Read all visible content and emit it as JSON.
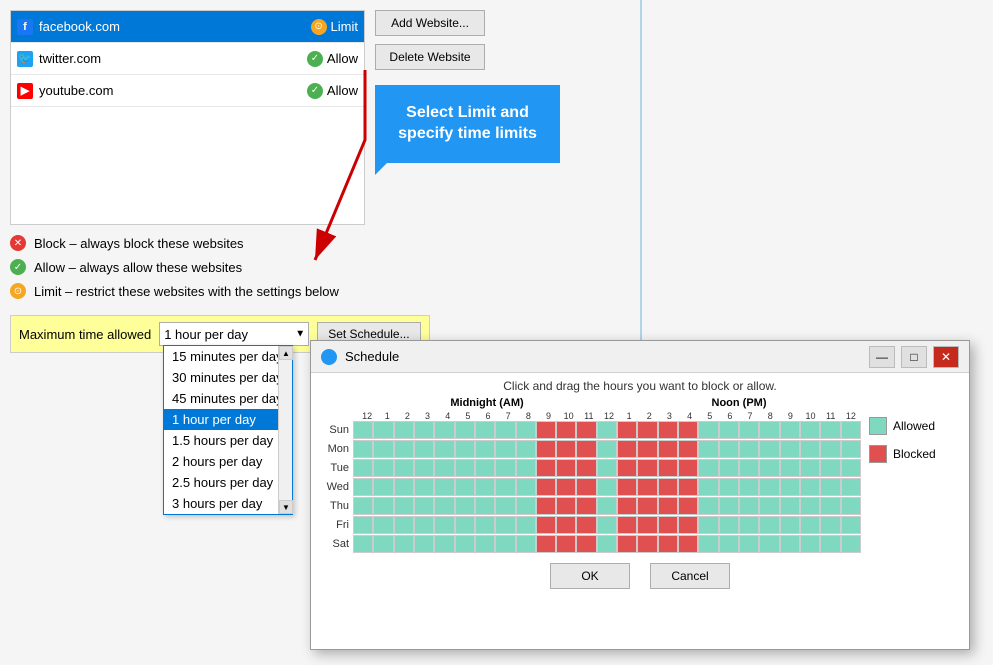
{
  "websites": [
    {
      "name": "facebook.com",
      "status": "Limit",
      "iconType": "fb",
      "iconChar": "f"
    },
    {
      "name": "twitter.com",
      "status": "Allow",
      "iconType": "tw",
      "iconChar": "t"
    },
    {
      "name": "youtube.com",
      "status": "Allow",
      "iconType": "yt",
      "iconChar": "▶"
    }
  ],
  "buttons": {
    "add_website": "Add Website...",
    "delete_website": "Delete Website",
    "set_schedule": "Set Schedule..."
  },
  "legend": {
    "block_text": "Block – always block these websites",
    "allow_text": "Allow – always allow these websites",
    "limit_text": "Limit – restrict these websites with the settings below"
  },
  "max_time": {
    "label": "Maximum time allowed",
    "selected": "1 hour per day"
  },
  "dropdown_options": [
    "15 minutes per day",
    "30 minutes per day",
    "45 minutes per day",
    "1 hour per day",
    "1.5 hours per day",
    "2 hours per day",
    "2.5 hours per day",
    "3 hours per day"
  ],
  "tooltip": {
    "text": "Select Limit and specify time limits"
  },
  "schedule_dialog": {
    "title": "Schedule",
    "subtitle": "Click and drag the hours you want to block or allow.",
    "midnight_label": "Midnight (AM)",
    "noon_label": "Noon (PM)",
    "days": [
      "Sun",
      "Mon",
      "Tue",
      "Wed",
      "Thu",
      "Fri",
      "Sat"
    ],
    "am_hours": [
      "12",
      "1",
      "2",
      "3",
      "4",
      "5",
      "6",
      "7",
      "8",
      "9",
      "10",
      "11",
      "12"
    ],
    "pm_hours": [
      "1",
      "2",
      "3",
      "4",
      "5",
      "6",
      "7",
      "8",
      "9",
      "10",
      "11",
      "12"
    ],
    "legend": {
      "allowed": "Allowed",
      "blocked": "Blocked"
    },
    "buttons": {
      "ok": "OK",
      "cancel": "Cancel"
    }
  }
}
